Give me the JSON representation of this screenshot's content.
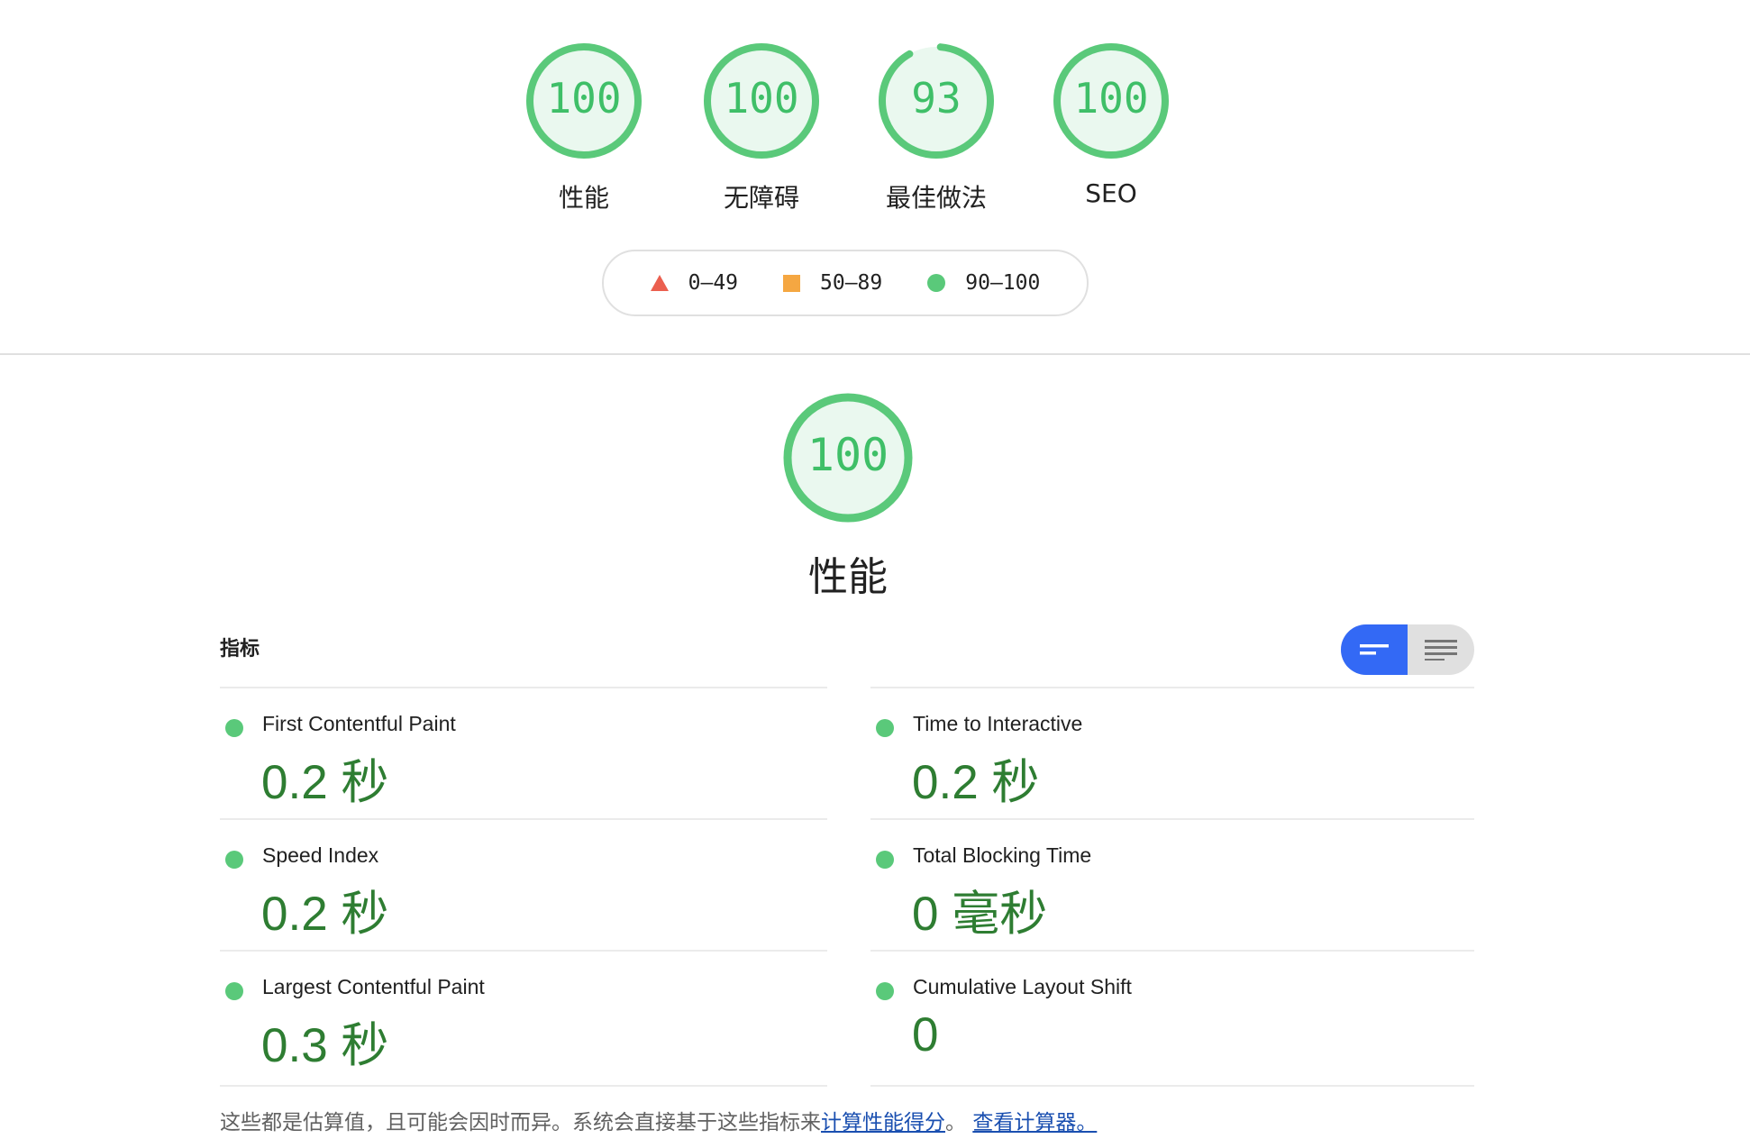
{
  "categories": [
    {
      "score": "100",
      "label": "性能",
      "value": 100
    },
    {
      "score": "100",
      "label": "无障碍",
      "value": 100
    },
    {
      "score": "93",
      "label": "最佳做法",
      "value": 93
    },
    {
      "score": "100",
      "label": "SEO",
      "value": 100
    }
  ],
  "legend": {
    "fail": "0–49",
    "average": "50–89",
    "pass": "90–100"
  },
  "performance": {
    "score": "100",
    "value": 100,
    "title": "性能"
  },
  "metrics": {
    "header": "指标",
    "items": [
      {
        "name": "First Contentful Paint",
        "value": "0.2 秒"
      },
      {
        "name": "Speed Index",
        "value": "0.2 秒"
      },
      {
        "name": "Largest Contentful Paint",
        "value": "0.3 秒"
      },
      {
        "name": "Time to Interactive",
        "value": "0.2 秒"
      },
      {
        "name": "Total Blocking Time",
        "value": "0 毫秒"
      },
      {
        "name": "Cumulative Layout Shift",
        "value": "0"
      }
    ]
  },
  "footnote": {
    "text": "这些都是估算值，且可能会因时而异。系统会直接基于这些指标来",
    "link1": "计算性能得分",
    "sep": "。",
    "link2": "查看计算器。"
  },
  "colors": {
    "pass": "#0cce6b",
    "pass_fill": "#eaf8ef",
    "value_text": "#2e7d32",
    "toggle_active": "#3369f5"
  }
}
